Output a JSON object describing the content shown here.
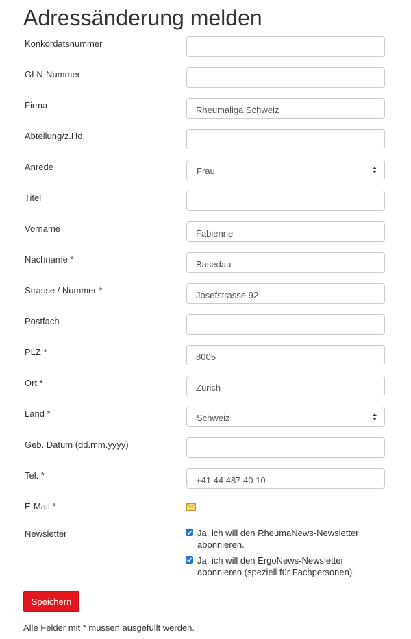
{
  "page_title": "Adressänderung melden",
  "fields": {
    "konkordatsnummer": {
      "label": "Konkordatsnummer",
      "value": ""
    },
    "gln_nummer": {
      "label": "GLN-Nummer",
      "value": ""
    },
    "firma": {
      "label": "Firma",
      "value": "Rheumaliga Schweiz"
    },
    "abteilung": {
      "label": "Abteilung/z.Hd.",
      "value": ""
    },
    "anrede": {
      "label": "Anrede",
      "value": "Frau"
    },
    "titel": {
      "label": "Titel",
      "value": ""
    },
    "vorname": {
      "label": "Vorname",
      "value": "Fabienne"
    },
    "nachname": {
      "label": "Nachname *",
      "value": "Basedau"
    },
    "strasse": {
      "label": "Strasse / Nummer *",
      "value": "Josefstrasse 92"
    },
    "postfach": {
      "label": "Postfach",
      "value": ""
    },
    "plz": {
      "label": "PLZ *",
      "value": "8005"
    },
    "ort": {
      "label": "Ort *",
      "value": "Zürich"
    },
    "land": {
      "label": "Land *",
      "value": "Schweiz"
    },
    "geb_datum": {
      "label": "Geb. Datum (dd.mm.yyyy)",
      "value": ""
    },
    "tel": {
      "label": "Tel. *",
      "value": "+41 44 487 40 10"
    },
    "email": {
      "label": "E-Mail *",
      "icon": "envelope-icon"
    }
  },
  "newsletter": {
    "label": "Newsletter",
    "options": [
      {
        "line1": "Ja, ich will den RheumaNews-Newsletter",
        "line2": "abonnieren.",
        "checked": true
      },
      {
        "line1": "Ja, ich will den ErgoNews-Newsletter",
        "line2": "abonnieren (speziell für Fachpersonen).",
        "checked": true
      }
    ]
  },
  "save_button": "Speichern",
  "required_note": "Alle Felder mit * müssen ausgefüllt werden.",
  "colors": {
    "accent_button": "#e3181f",
    "checkbox": "#1f76d8",
    "border": "#cccccc"
  }
}
